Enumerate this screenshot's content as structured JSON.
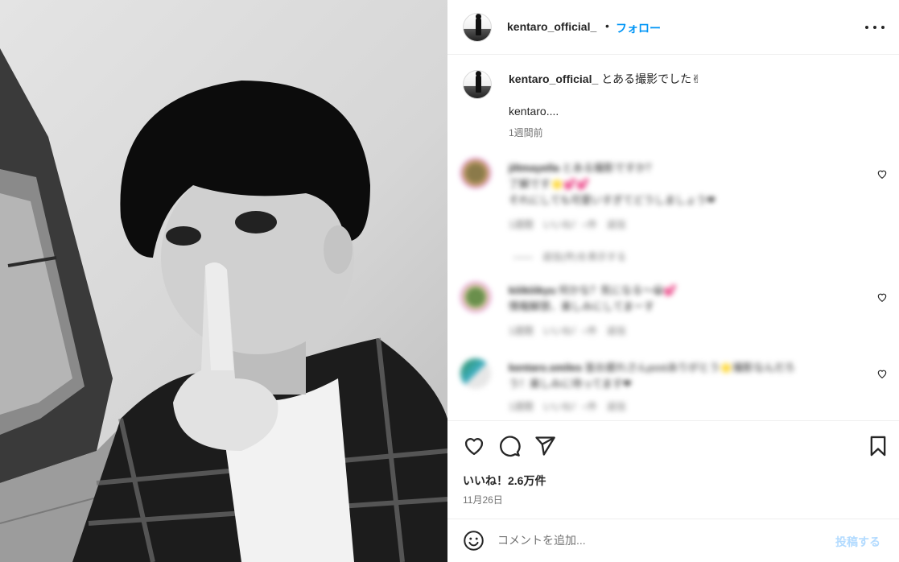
{
  "post": {
    "username": "kentaro_official_",
    "separator": "•",
    "follow_label": "フォロー",
    "more_icon": "more-horizontal-icon",
    "caption_text": "とある撮影でした✌",
    "caption_line2": "kentaro....",
    "time_ago": "1週間前",
    "likes_label": "いいね！2.6万件",
    "date": "11月26日"
  },
  "comments": [
    {
      "username": "jiltmayella",
      "line1": "とある撮影ですか？",
      "line2": "了解です🌟💕💕",
      "line3": "それにしても可愛いすぎてどうしましょう❤",
      "meta": "1週間　いいね！○件　返信",
      "replies": "——　返信(件)を表示する"
    },
    {
      "username": "kiiikiiikyu",
      "line1": "何かな？気になる〜😀💕",
      "line2": "情報解禁、楽しみにしてまーす",
      "meta": "1週間　いいね！○件　返信"
    },
    {
      "username": "kentaro.smiles",
      "line1": "皆お疲れさんpostありがとう🌟撮影なんだろ",
      "line2": "う！楽しみに待ってます❤",
      "meta": "1週間　いいね！○件　返信"
    }
  ],
  "comment_box": {
    "placeholder": "コメントを追加...",
    "post_label": "投稿する"
  },
  "colors": {
    "accent": "#0095f6",
    "post_disabled": "#b3dbff",
    "text": "#262626",
    "muted": "#737373"
  }
}
